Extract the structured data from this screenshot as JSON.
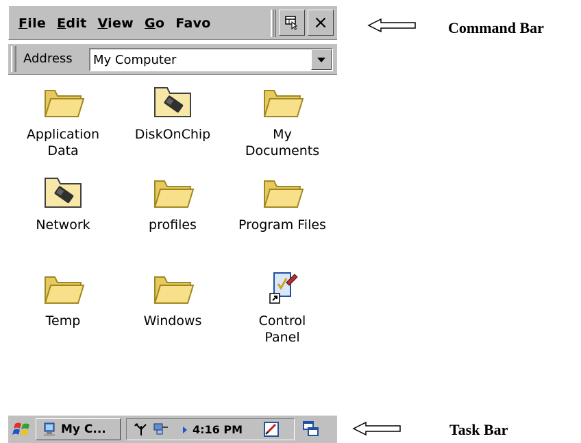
{
  "menu": {
    "file": {
      "u": "F",
      "rest": "ile"
    },
    "edit": {
      "u": "E",
      "rest": "dit"
    },
    "view": {
      "u": "V",
      "rest": "iew"
    },
    "go": {
      "u": "G",
      "rest": "o"
    },
    "favorites": {
      "u": "",
      "rest": "Favorites"
    }
  },
  "address": {
    "label": "Address",
    "value": "My Computer"
  },
  "items": [
    {
      "line1": "Application",
      "line2": "Data",
      "icon": "folder-icon"
    },
    {
      "line1": "DiskOnChip",
      "line2": "",
      "icon": "storage-folder-icon"
    },
    {
      "line1": "My",
      "line2": "Documents",
      "icon": "folder-icon"
    },
    {
      "line1": "Network",
      "line2": "",
      "icon": "storage-folder-icon"
    },
    {
      "line1": "profiles",
      "line2": "",
      "icon": "folder-icon"
    },
    {
      "line1": "Program Files",
      "line2": "",
      "icon": "folder-icon"
    },
    {
      "line1": "Temp",
      "line2": "",
      "icon": "folder-icon"
    },
    {
      "line1": "Windows",
      "line2": "",
      "icon": "folder-icon"
    },
    {
      "line1": "Control",
      "line2": "Panel",
      "icon": "control-panel-icon"
    }
  ],
  "taskbar": {
    "task_label": "My C...",
    "time": "4:16 PM"
  },
  "annotations": {
    "command_bar": "Command Bar",
    "task_bar": "Task Bar"
  },
  "colors": {
    "chrome": "#c0c0c0",
    "folder_yellow": "#f8e08a",
    "folder_outline": "#a08820"
  }
}
